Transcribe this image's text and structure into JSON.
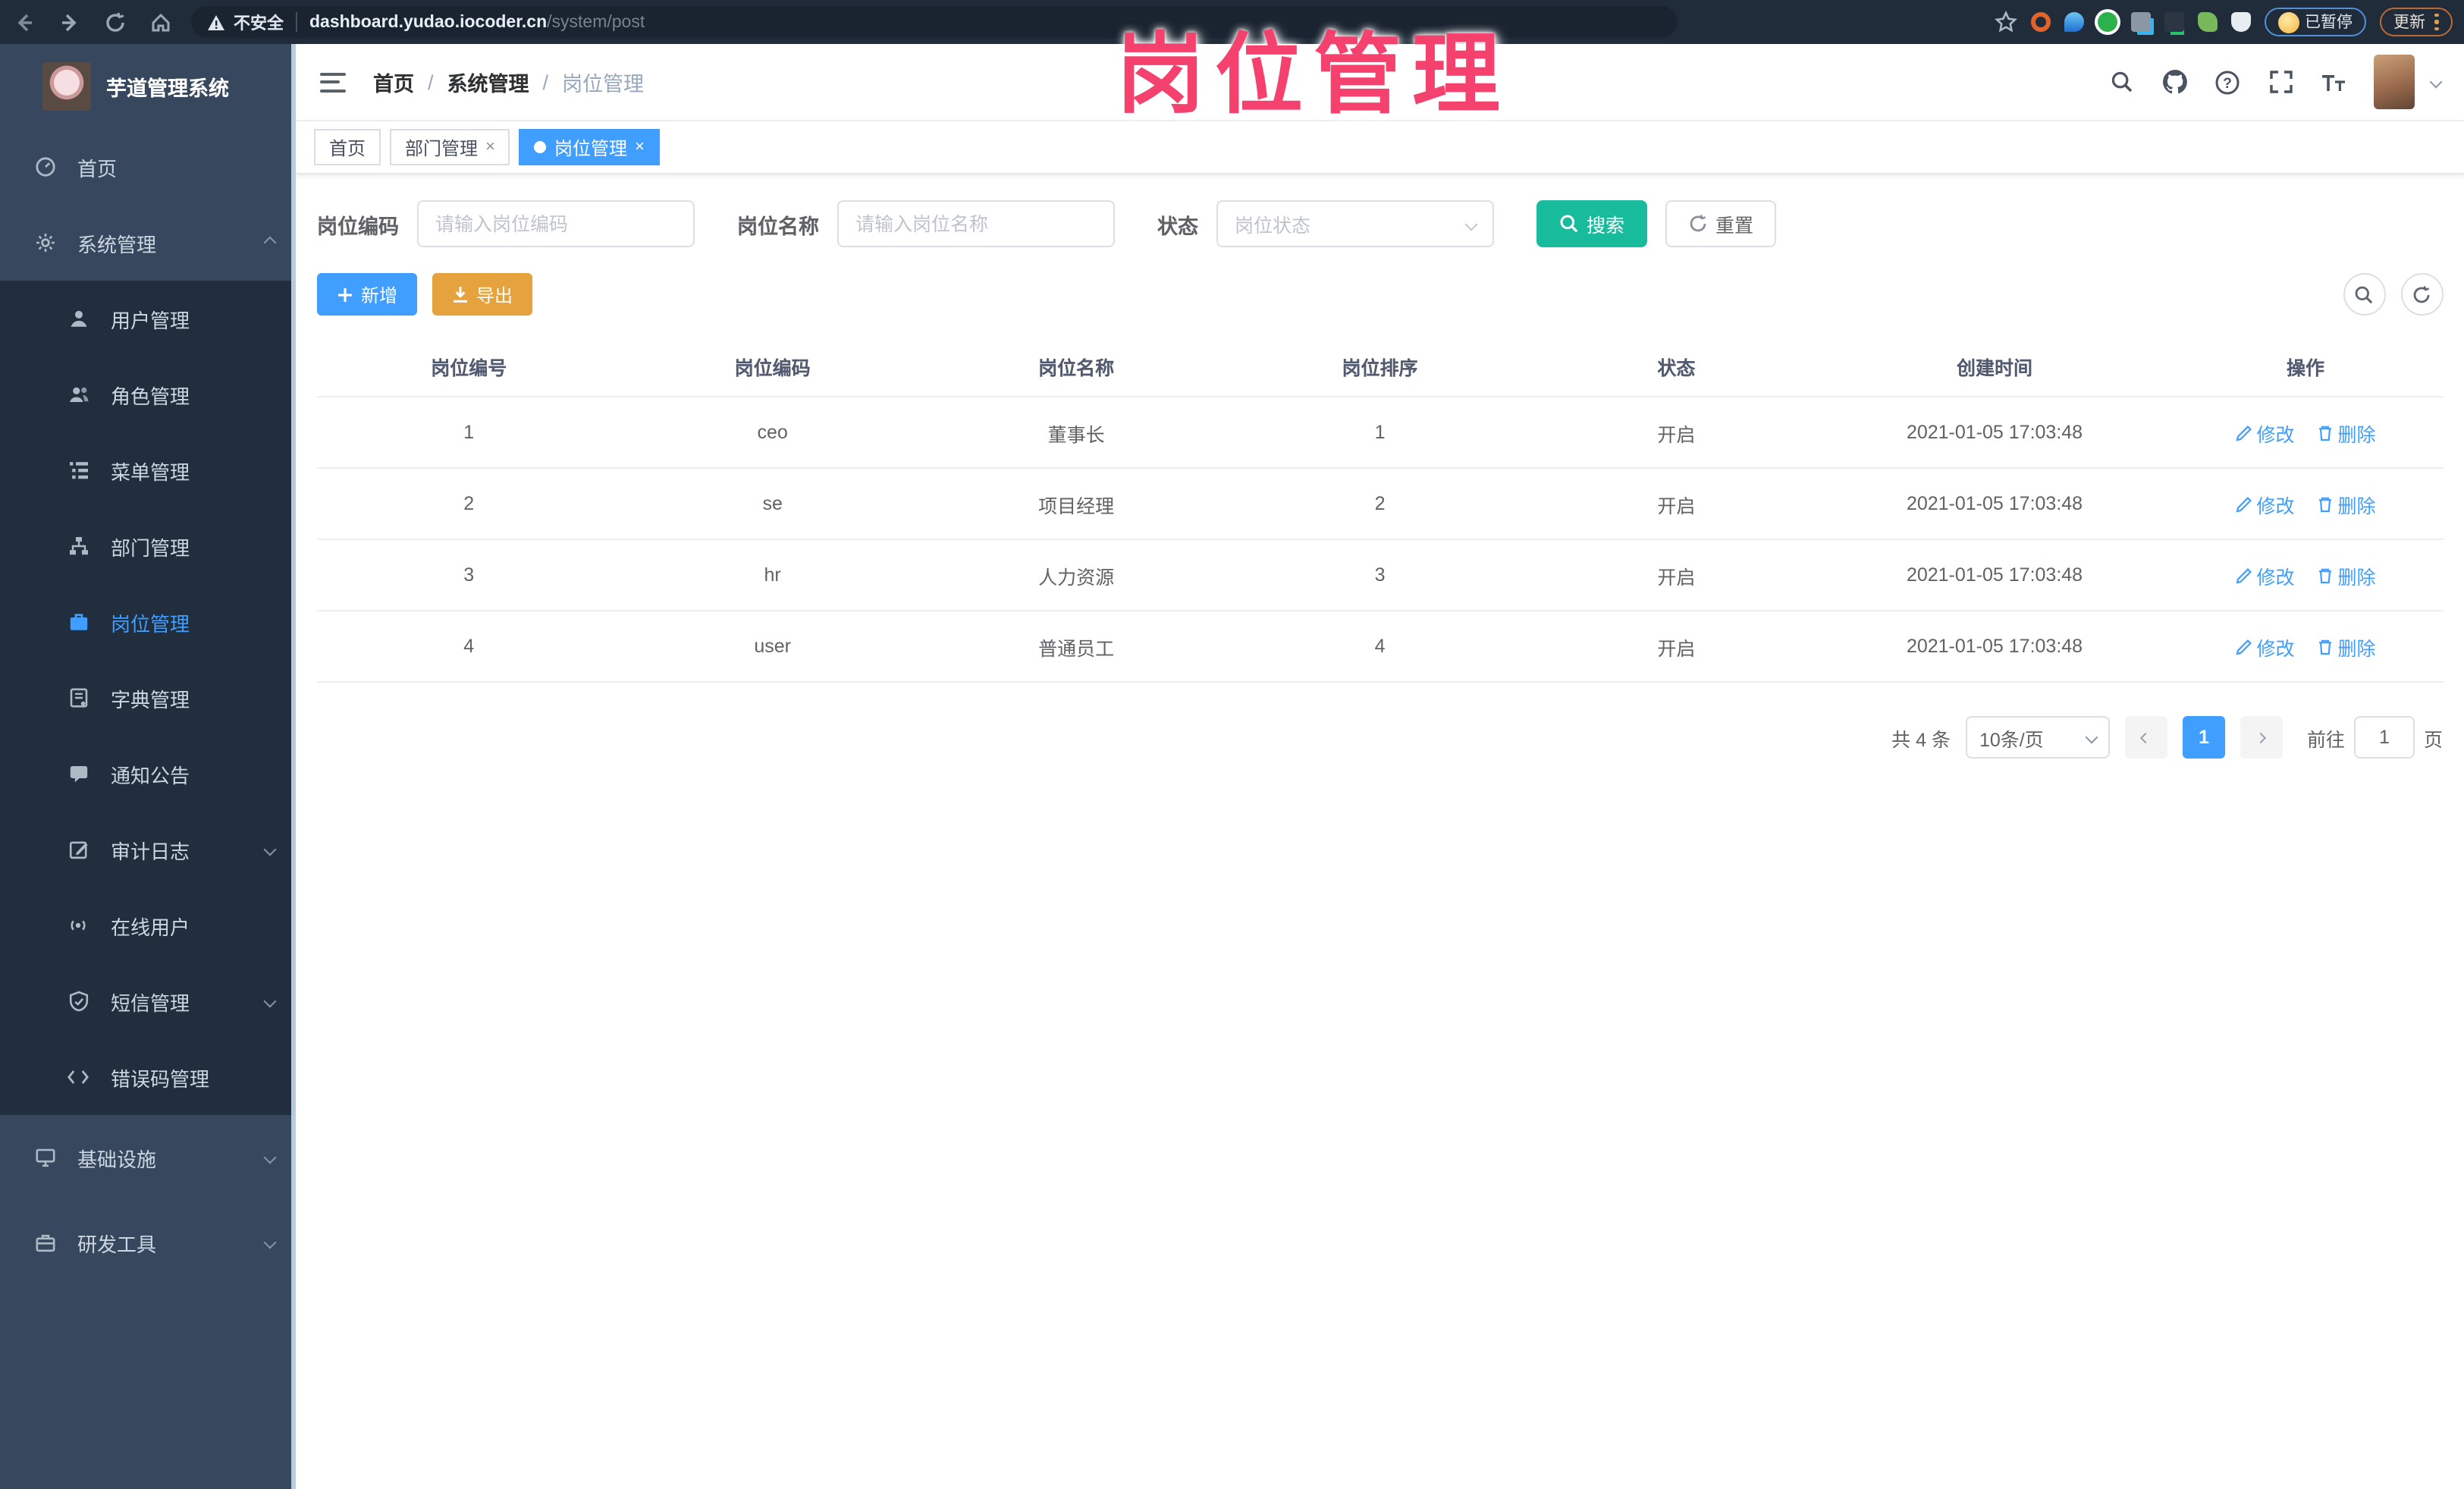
{
  "browser": {
    "security_label": "不安全",
    "url_host": "dashboard.yudao.iocoder.cn",
    "url_path": "/system/post",
    "paused_badge_label": "已暂停",
    "update_button_label": "更新"
  },
  "overlay": {
    "title": "岗位管理",
    "color": "#f5416d"
  },
  "sidebar": {
    "app_title": "芋道管理系统",
    "top_items": [
      {
        "label": "首页"
      },
      {
        "label": "系统管理"
      }
    ],
    "sub_items": [
      {
        "label": "用户管理"
      },
      {
        "label": "角色管理"
      },
      {
        "label": "菜单管理"
      },
      {
        "label": "部门管理"
      },
      {
        "label": "岗位管理"
      },
      {
        "label": "字典管理"
      },
      {
        "label": "通知公告"
      },
      {
        "label": "审计日志"
      },
      {
        "label": "在线用户"
      },
      {
        "label": "短信管理"
      },
      {
        "label": "错误码管理"
      }
    ],
    "bottom_items": [
      {
        "label": "基础设施"
      },
      {
        "label": "研发工具"
      }
    ]
  },
  "header": {
    "breadcrumb": [
      "首页",
      "系统管理",
      "岗位管理"
    ]
  },
  "tabs": [
    {
      "label": "首页"
    },
    {
      "label": "部门管理"
    },
    {
      "label": "岗位管理"
    }
  ],
  "filters": {
    "code_label": "岗位编码",
    "code_placeholder": "请输入岗位编码",
    "name_label": "岗位名称",
    "name_placeholder": "请输入岗位名称",
    "status_label": "状态",
    "status_placeholder": "岗位状态",
    "search_label": "搜索",
    "reset_label": "重置"
  },
  "toolbar": {
    "add_label": "新增",
    "export_label": "导出"
  },
  "table": {
    "headers": [
      "岗位编号",
      "岗位编码",
      "岗位名称",
      "岗位排序",
      "状态",
      "创建时间",
      "操作"
    ],
    "rows": [
      {
        "id": "1",
        "code": "ceo",
        "name": "董事长",
        "sort": "1",
        "status": "开启",
        "created": "2021-01-05 17:03:48"
      },
      {
        "id": "2",
        "code": "se",
        "name": "项目经理",
        "sort": "2",
        "status": "开启",
        "created": "2021-01-05 17:03:48"
      },
      {
        "id": "3",
        "code": "hr",
        "name": "人力资源",
        "sort": "3",
        "status": "开启",
        "created": "2021-01-05 17:03:48"
      },
      {
        "id": "4",
        "code": "user",
        "name": "普通员工",
        "sort": "4",
        "status": "开启",
        "created": "2021-01-05 17:03:48"
      }
    ],
    "edit_label": "修改",
    "delete_label": "删除"
  },
  "pagination": {
    "total_text": "共 4 条",
    "page_size": "10条/页",
    "current_page": "1",
    "goto_label": "前往",
    "goto_value": "1",
    "page_unit": "页"
  },
  "colors": {
    "accent": "#409eff",
    "search_button": "#18bc9c",
    "export_button": "#e6a23c",
    "sidebar_bg": "#37485e",
    "submenu_bg": "#202e3d",
    "overlay_pink": "#f5416d"
  }
}
